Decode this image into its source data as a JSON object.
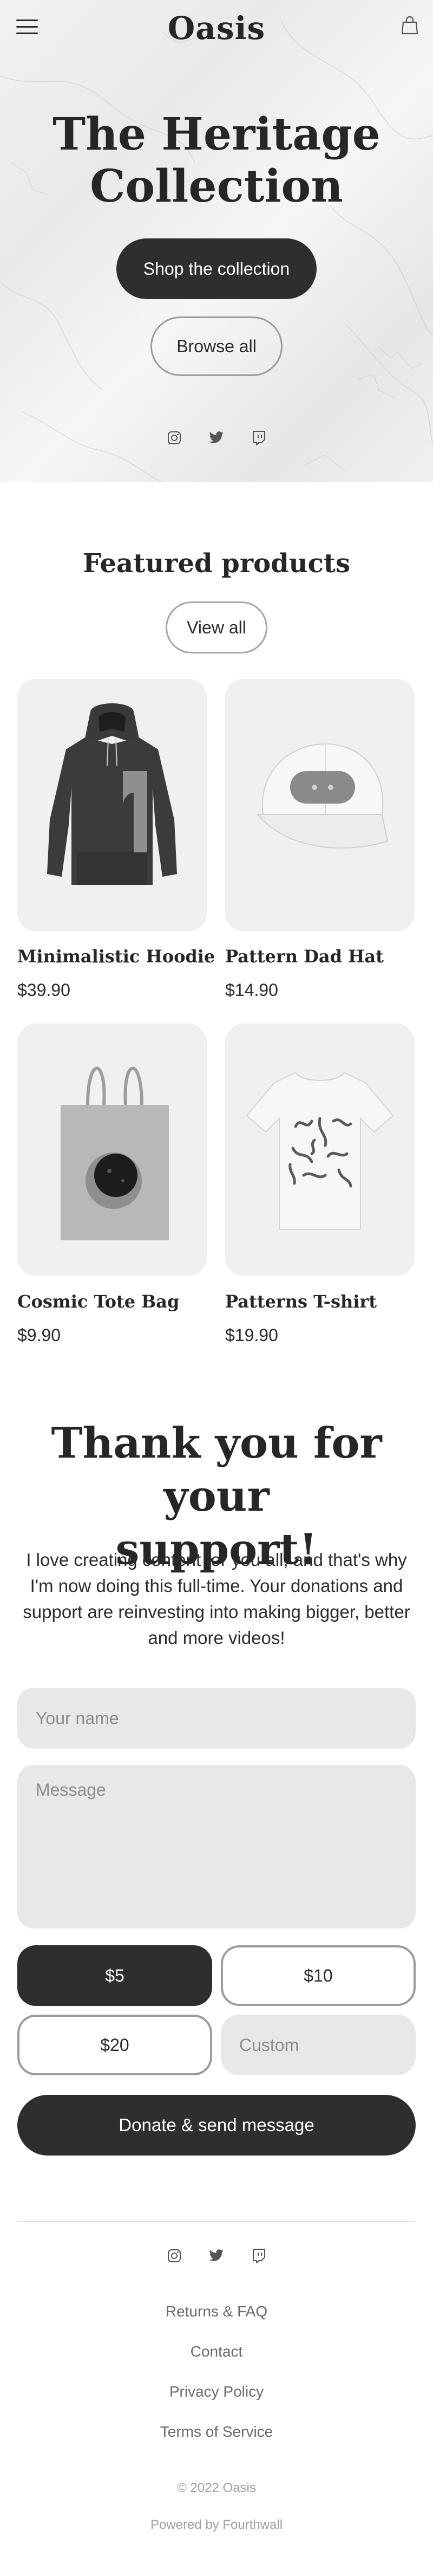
{
  "header": {
    "logo": "Oasis",
    "menu_icon": "hamburger-menu-icon",
    "cart_icon": "shopping-bag-icon"
  },
  "hero": {
    "title_line1": "The Heritage",
    "title_line2": "Collection",
    "primary_button": "Shop the collection",
    "secondary_button": "Browse all",
    "social_icons": [
      "instagram-icon",
      "twitter-icon",
      "twitch-icon"
    ]
  },
  "featured": {
    "title": "Featured products",
    "view_all": "View all",
    "products": [
      {
        "name": "Minimalistic Hoodie",
        "price": "$39.90",
        "image": "hoodie-image"
      },
      {
        "name": "Pattern Dad Hat",
        "price": "$14.90",
        "image": "cap-image"
      },
      {
        "name": "Cosmic Tote Bag",
        "price": "$9.90",
        "image": "tote-bag-image"
      },
      {
        "name": "Patterns T-shirt",
        "price": "$19.90",
        "image": "tshirt-image"
      }
    ]
  },
  "support": {
    "title_line1": "Thank you for your",
    "title_line2": "support!",
    "text": "I love creating content for you all, and that's why I'm now doing this full-time. Your donations and support are reinvesting into making bigger, better and more videos!",
    "name_placeholder": "Your name",
    "message_placeholder": "Message",
    "amounts": [
      "$5",
      "$10",
      "$20"
    ],
    "selected_amount": "$5",
    "custom_placeholder": "Custom",
    "donate_button": "Donate & send message"
  },
  "footer": {
    "social_icons": [
      "instagram-icon",
      "twitter-icon",
      "twitch-icon"
    ],
    "links": [
      "Returns & FAQ",
      "Contact",
      "Privacy Policy",
      "Terms of Service"
    ],
    "copyright": "© 2022 Oasis",
    "powered_by": "Powered by Fourthwall"
  },
  "colors": {
    "dark": "#2e2e2e",
    "card_background": "#f0f0f0",
    "input_background": "#e8e8e8",
    "muted_text": "#6a6a6a"
  }
}
